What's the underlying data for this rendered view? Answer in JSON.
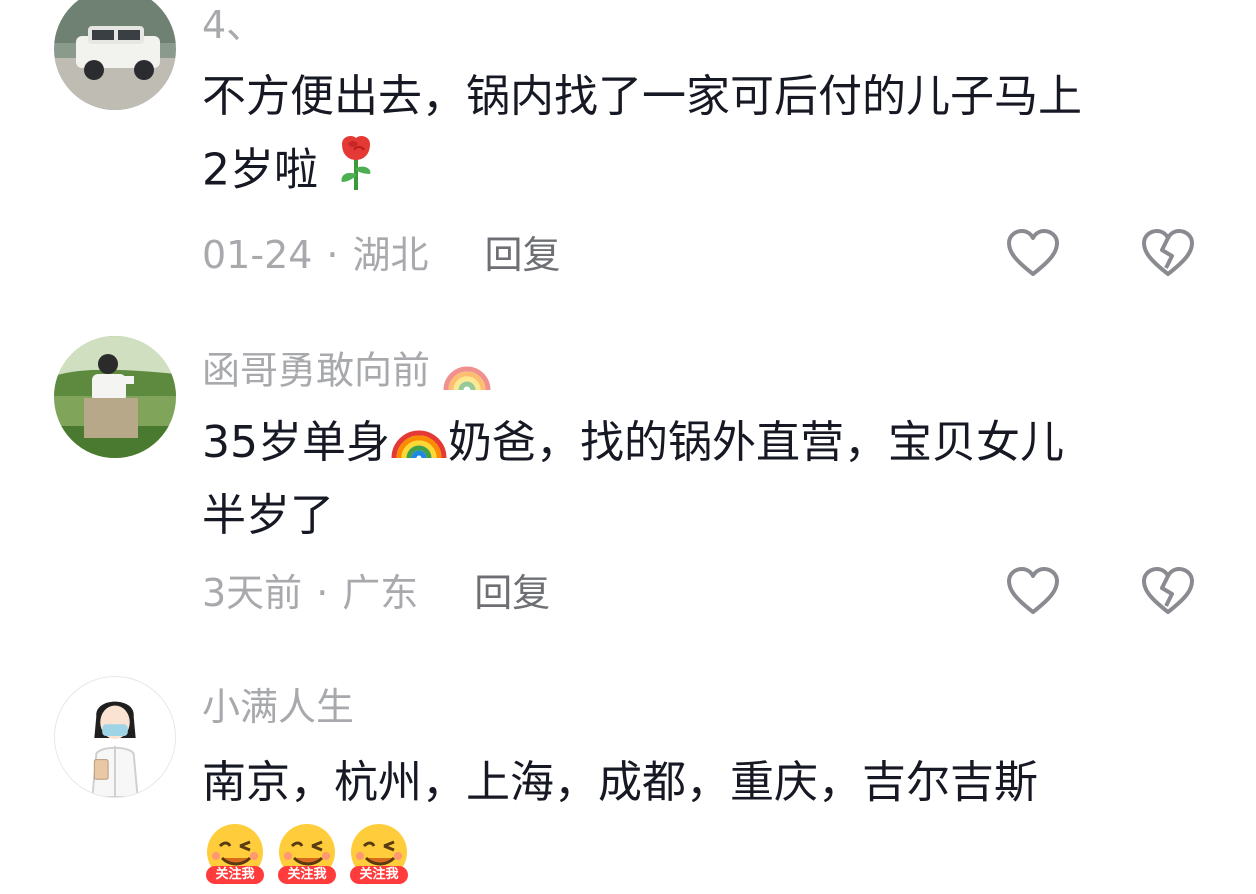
{
  "comments": [
    {
      "username": "4、",
      "text_line1": "不方便出去，锅内找了一家可后付的儿子马上",
      "text_line2": "2岁啦",
      "date": "01-24",
      "location": "湖北",
      "reply": "回复",
      "avatar": "car-avatar"
    },
    {
      "username": "函哥勇敢向前",
      "text_line1a": "35岁单身",
      "text_line1b": "奶爸，找的锅外直营，宝贝女儿",
      "text_line2": "半岁了",
      "date": "3天前",
      "location": "广东",
      "reply": "回复",
      "avatar": "person-field-avatar"
    },
    {
      "username": "小满人生",
      "text_line1": "南京，杭州，上海，成都，重庆，吉尔吉斯",
      "avatar": "nurse-cartoon-avatar",
      "sticker_label": "关注我",
      "sticker_count": 3
    }
  ],
  "separator": "·",
  "icons": {
    "like": "heart-outline-icon",
    "dislike": "broken-heart-icon",
    "rose": "rose-emoji",
    "rainbow": "rainbow-emoji"
  },
  "colors": {
    "text": "#161823",
    "meta": "#a8a9ad",
    "reply": "#6e6f74"
  }
}
